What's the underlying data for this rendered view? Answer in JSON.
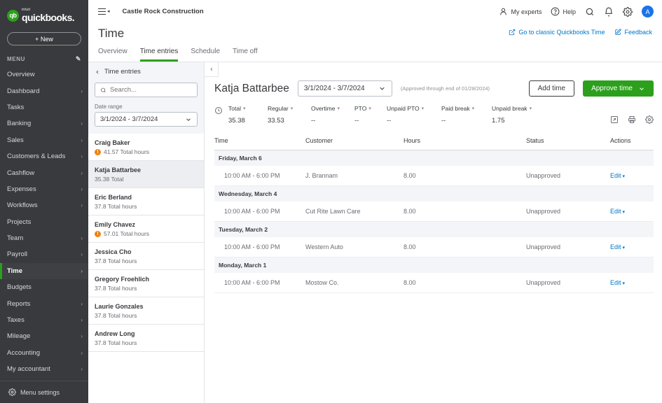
{
  "sidebar": {
    "brand": {
      "mark": "qb",
      "intuit": "intuit",
      "name": "quickbooks."
    },
    "new_button": "+ New",
    "menu_label": "MENU",
    "pencil_icon": "✎",
    "items": [
      {
        "label": "Overview",
        "chevron": ""
      },
      {
        "label": "Dashboard",
        "chevron": "›"
      },
      {
        "label": "Tasks",
        "chevron": ""
      },
      {
        "label": "Banking",
        "chevron": "›"
      },
      {
        "label": "Sales",
        "chevron": "›"
      },
      {
        "label": "Customers & Leads",
        "chevron": "›"
      },
      {
        "label": "Cashflow",
        "chevron": "›"
      },
      {
        "label": "Expenses",
        "chevron": "›"
      },
      {
        "label": "Workflows",
        "chevron": "›"
      },
      {
        "label": "Projects",
        "chevron": ""
      },
      {
        "label": "Team",
        "chevron": "›"
      },
      {
        "label": "Payroll",
        "chevron": "›"
      },
      {
        "label": "Time",
        "chevron": "›",
        "active": true
      },
      {
        "label": "Budgets",
        "chevron": ""
      },
      {
        "label": "Reports",
        "chevron": "›"
      },
      {
        "label": "Taxes",
        "chevron": "›"
      },
      {
        "label": "Mileage",
        "chevron": "›"
      },
      {
        "label": "Accounting",
        "chevron": "›"
      },
      {
        "label": "My accountant",
        "chevron": "›"
      }
    ],
    "menu_settings": "Menu settings",
    "accent_color": "#2ca01c",
    "background_color": "#393a3d"
  },
  "topbar": {
    "company": "Castle Rock Construction",
    "my_experts": "My experts",
    "help": "Help",
    "avatar_initial": "A"
  },
  "page": {
    "title": "Time",
    "links": [
      {
        "label": "Go to classic Quickbooks Time"
      },
      {
        "label": "Feedback"
      }
    ],
    "tabs": [
      {
        "label": "Overview",
        "active": false
      },
      {
        "label": "Time entries",
        "active": true
      },
      {
        "label": "Schedule",
        "active": false
      },
      {
        "label": "Time off",
        "active": false
      }
    ]
  },
  "listpane": {
    "back_label": "Time entries",
    "search_placeholder": "Search...",
    "date_range_label": "Date range",
    "date_range_value": "3/1/2024 - 3/7/2024",
    "employees": [
      {
        "name": "Craig Baker",
        "hours": "41.57 Total hours",
        "warning": true,
        "selected": false
      },
      {
        "name": "Katja Battarbee",
        "hours": "35.38 Total",
        "warning": false,
        "selected": true
      },
      {
        "name": "Eric Berland",
        "hours": "37.8 Total hours",
        "warning": false,
        "selected": false
      },
      {
        "name": "Emily Chavez",
        "hours": "57.01 Total hours",
        "warning": true,
        "selected": false
      },
      {
        "name": "Jessica Cho",
        "hours": "37.8 Total hours",
        "warning": false,
        "selected": false
      },
      {
        "name": "Gregory Froehlich",
        "hours": "37.8 Total hours",
        "warning": false,
        "selected": false
      },
      {
        "name": "Laurie Gonzales",
        "hours": "37.8 Total hours",
        "warning": false,
        "selected": false
      },
      {
        "name": "Andrew Long",
        "hours": "37.8 Total hours",
        "warning": false,
        "selected": false
      }
    ]
  },
  "detail": {
    "person_name": "Katja Battarbee",
    "date_range_value": "3/1/2024 - 3/7/2024",
    "approved_note": "(Approved through end of 01/28/2024)",
    "add_time_button": "Add time",
    "approve_time_button": "Approve time",
    "stats": [
      {
        "label": "Total",
        "value": "35.38"
      },
      {
        "label": "Regular",
        "value": "33.53"
      },
      {
        "label": "Overtime",
        "value": "--"
      },
      {
        "label": "PTO",
        "value": "--"
      },
      {
        "label": "Unpaid PTO",
        "value": "--"
      },
      {
        "label": "Paid break",
        "value": "--"
      },
      {
        "label": "Unpaid break",
        "value": "1.75"
      }
    ],
    "table": {
      "columns": [
        "Time",
        "Customer",
        "Hours",
        "Status",
        "Actions"
      ],
      "groups": [
        {
          "date": "Friday, March 6",
          "rows": [
            {
              "time": "10:00 AM - 6:00 PM",
              "customer": "J. Brannam",
              "hours": "8.00",
              "status": "Unapproved",
              "action": "Edit"
            }
          ]
        },
        {
          "date": "Wednesday, March 4",
          "rows": [
            {
              "time": "10:00 AM - 6:00 PM",
              "customer": "Cut Rite Lawn Care",
              "hours": "8.00",
              "status": "Unapproved",
              "action": "Edit"
            }
          ]
        },
        {
          "date": "Tuesday, March 2",
          "rows": [
            {
              "time": "10:00 AM - 6:00 PM",
              "customer": "Western Auto",
              "hours": "8.00",
              "status": "Unapproved",
              "action": "Edit"
            }
          ]
        },
        {
          "date": "Monday, March 1",
          "rows": [
            {
              "time": "10:00 AM - 6:00 PM",
              "customer": "Mostow Co.",
              "hours": "8.00",
              "status": "Unapproved",
              "action": "Edit"
            }
          ]
        }
      ]
    }
  }
}
